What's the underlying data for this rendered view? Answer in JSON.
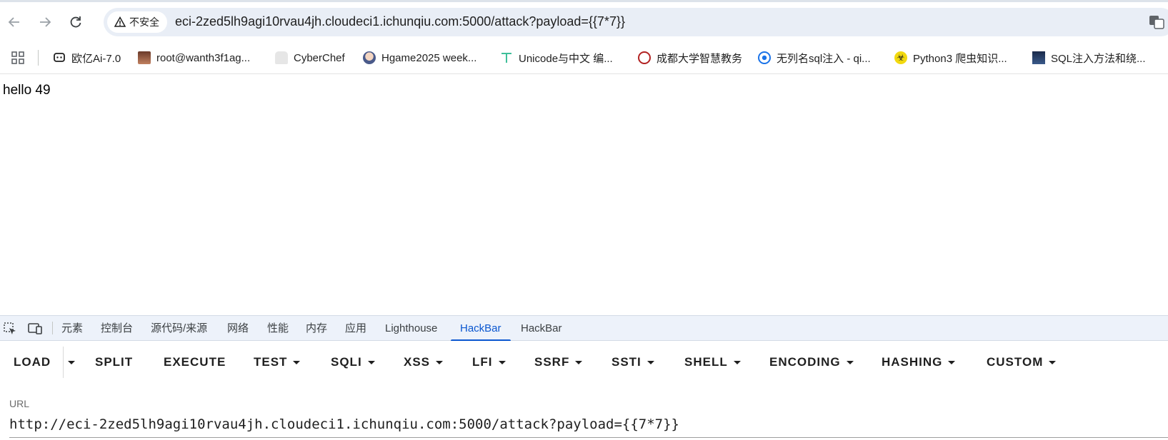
{
  "browser": {
    "security_label": "不安全",
    "address": "eci-2zed5lh9agi10rvau4jh.cloudeci1.ichunqiu.com:5000/attack?payload={{7*7}}"
  },
  "bookmarks": [
    {
      "label": "欧亿Ai-7.0",
      "icon": "chat-bubble-icon"
    },
    {
      "label": "root@wanth3f1ag...",
      "icon": "avatar-icon"
    },
    {
      "label": "CyberChef",
      "icon": "chef-hat-icon"
    },
    {
      "label": "Hgame2025 week...",
      "icon": "anime-avatar-icon"
    },
    {
      "label": "Unicode与中文 编...",
      "icon": "t-logo-icon"
    },
    {
      "label": "成都大学智慧教务",
      "icon": "university-seal-icon"
    },
    {
      "label": "无列名sql注入 - qi...",
      "icon": "blue-circle-icon"
    },
    {
      "label": "Python3 爬虫知识...",
      "icon": "biohazard-icon"
    },
    {
      "label": "SQL注入方法和绕...",
      "icon": "thumbnail-icon"
    }
  ],
  "page": {
    "text": "hello 49"
  },
  "devtools": {
    "tabs": [
      "元素",
      "控制台",
      "源代码/来源",
      "网络",
      "性能",
      "内存",
      "应用",
      "Lighthouse",
      "HackBar",
      "HackBar"
    ],
    "active_tab_index": 8
  },
  "hackbar": {
    "buttons": [
      {
        "label": "LOAD",
        "dropdown": false
      },
      {
        "label": "SPLIT",
        "dropdown": false
      },
      {
        "label": "EXECUTE",
        "dropdown": false
      },
      {
        "label": "TEST",
        "dropdown": true
      },
      {
        "label": "SQLI",
        "dropdown": true
      },
      {
        "label": "XSS",
        "dropdown": true
      },
      {
        "label": "LFI",
        "dropdown": true
      },
      {
        "label": "SSRF",
        "dropdown": true
      },
      {
        "label": "SSTI",
        "dropdown": true
      },
      {
        "label": "SHELL",
        "dropdown": true
      },
      {
        "label": "ENCODING",
        "dropdown": true
      },
      {
        "label": "HASHING",
        "dropdown": true
      },
      {
        "label": "CUSTOM",
        "dropdown": true
      }
    ],
    "url_label": "URL",
    "url_value": "http://eci-2zed5lh9agi10rvau4jh.cloudeci1.ichunqiu.com:5000/attack?payload={{7*7}}"
  },
  "colors": {
    "accent": "#0b57d0",
    "omnibox_bg": "#e9eef6",
    "devtools_bg": "#edf2fa"
  }
}
